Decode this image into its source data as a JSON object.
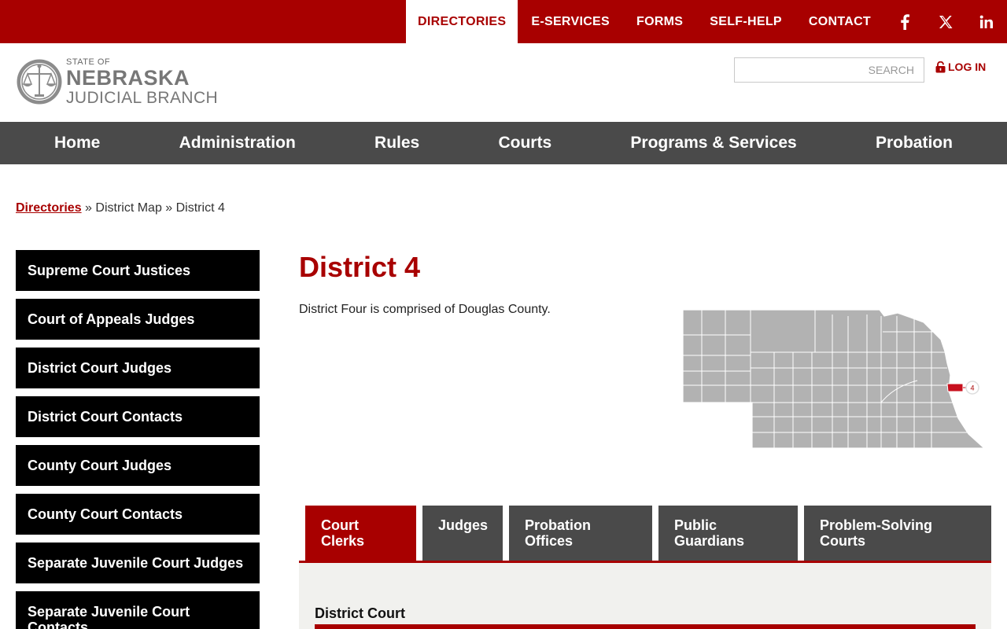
{
  "topnav": {
    "links": [
      "DIRECTORIES",
      "E-SERVICES",
      "FORMS",
      "SELF-HELP",
      "CONTACT"
    ],
    "social_icons": [
      "facebook-icon",
      "x-icon",
      "linkedin-icon"
    ]
  },
  "header": {
    "logo_line1": "STATE OF",
    "logo_line2": "NEBRASKA",
    "logo_line3": "JUDICIAL BRANCH",
    "search_placeholder": "SEARCH",
    "login_label": "LOG IN"
  },
  "mainnav": [
    "Home",
    "Administration",
    "Rules",
    "Courts",
    "Programs & Services",
    "Probation"
  ],
  "breadcrumb": {
    "link": "Directories",
    "rest": " » District Map » District 4"
  },
  "sidebar": [
    "Supreme Court Justices",
    "Court of Appeals Judges",
    "District Court Judges",
    "District Court Contacts",
    "County Court Judges",
    "County Court Contacts",
    "Separate Juvenile Court Judges",
    "Separate Juvenile Court Contacts"
  ],
  "content": {
    "title": "District 4",
    "intro": "District Four is comprised of Douglas County.",
    "map_label": "4"
  },
  "tabs": [
    "Court Clerks",
    "Judges",
    "Probation Offices",
    "Public Guardians",
    "Problem-Solving Courts"
  ],
  "panel": {
    "heading": "District Court"
  },
  "colors": {
    "brand_red": "#a80000",
    "nav_gray": "#4a4a4a",
    "county_gray": "#b2b2b2"
  }
}
